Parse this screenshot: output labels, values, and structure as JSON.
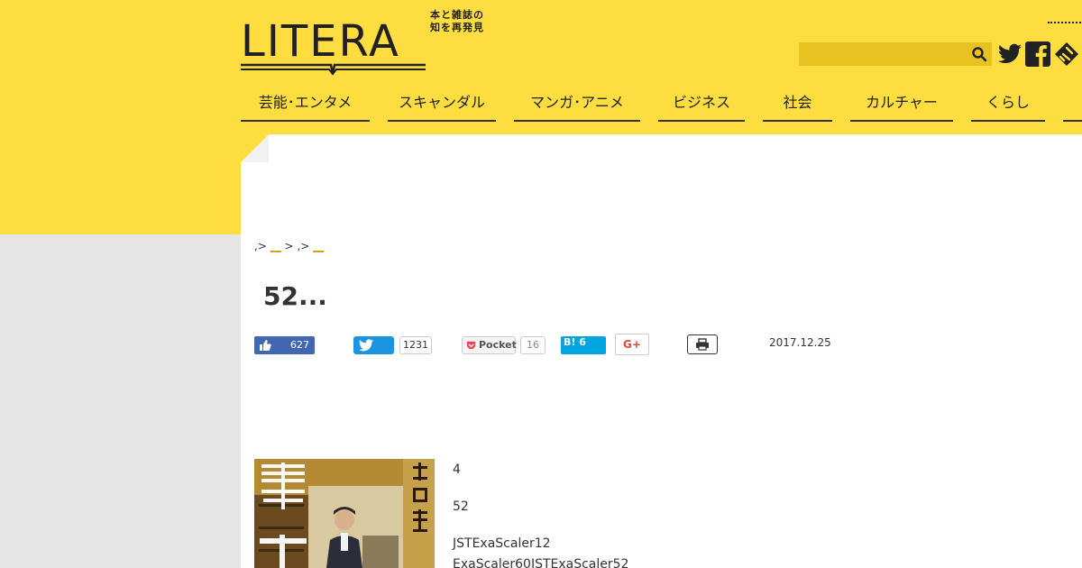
{
  "logo": {
    "text": "LITERA",
    "tagline_line1": "本と雑誌の",
    "tagline_line2": "知を再発見"
  },
  "search": {
    "placeholder": "",
    "value": ""
  },
  "social": [
    "twitter-icon",
    "facebook-icon",
    "feedly-icon"
  ],
  "nav": [
    {
      "label": "芸能･エンタメ"
    },
    {
      "label": "スキャンダル"
    },
    {
      "label": "マンガ･アニメ"
    },
    {
      "label": "ビジネス"
    },
    {
      "label": "社会"
    },
    {
      "label": "カルチャー"
    },
    {
      "label": "くらし"
    }
  ],
  "breadcrumb": {
    "sep1": ",",
    "arrow": ">",
    "link1": "__",
    "sep2": ",",
    "link2": "__"
  },
  "article": {
    "title": "52...",
    "date": "2017.12.25"
  },
  "share": {
    "like_count": "627",
    "tweet_count": "1231",
    "pocket_label": "Pocket",
    "pocket_count": "16",
    "hatena_label": "B! 6",
    "gplus_label": "G+"
  },
  "body": [
    "4",
    "52",
    "JSTExaScaler12",
    "ExaScaler60JSTExaScaler52"
  ],
  "colors": {
    "brand_yellow": "#fedd40",
    "facebook": "#4267b2",
    "twitter": "#1b95e0",
    "hatena": "#00a4de",
    "link": "#d99a00"
  }
}
